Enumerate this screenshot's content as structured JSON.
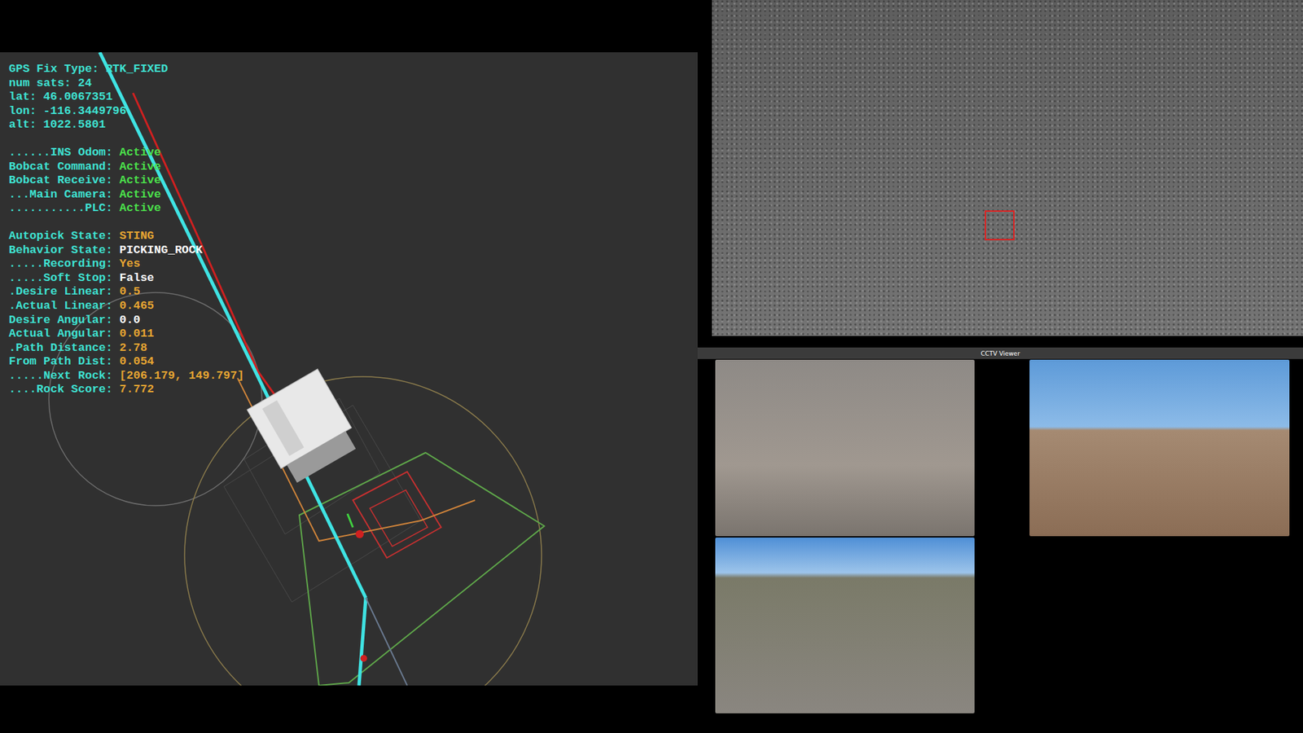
{
  "status_groups": [
    [
      {
        "label": "GPS Fix Type:",
        "value": "RTK_FIXED",
        "color": "#3fe3d3"
      },
      {
        "label": "num sats:",
        "value": "24",
        "color": "#3fe3d3"
      },
      {
        "label": "lat:",
        "value": "46.0067351",
        "color": "#3fe3d3"
      },
      {
        "label": "lon:",
        "value": "-116.3449796",
        "color": "#3fe3d3"
      },
      {
        "label": "alt:",
        "value": "1022.5801",
        "color": "#3fe3d3"
      }
    ],
    [
      {
        "label": "......INS Odom:",
        "value": "Active",
        "color": "#4be24b"
      },
      {
        "label": "Bobcat Command:",
        "value": "Active",
        "color": "#4be24b"
      },
      {
        "label": "Bobcat Receive:",
        "value": "Active",
        "color": "#4be24b"
      },
      {
        "label": "...Main Camera:",
        "value": "Active",
        "color": "#4be24b"
      },
      {
        "label": "...........PLC:",
        "value": "Active",
        "color": "#4be24b"
      }
    ],
    [
      {
        "label": "Autopick State:",
        "value": "STING",
        "color": "#e8a632"
      },
      {
        "label": "Behavior State:",
        "value": "PICKING_ROCK",
        "color": "#ffffff"
      },
      {
        "label": ".....Recording:",
        "value": "Yes",
        "color": "#e8a632"
      },
      {
        "label": ".....Soft Stop:",
        "value": "False",
        "color": "#ffffff"
      },
      {
        "label": ".Desire Linear:",
        "value": "0.5",
        "color": "#e8a632"
      },
      {
        "label": ".Actual Linear:",
        "value": "0.465",
        "color": "#e8a632"
      },
      {
        "label": "Desire Angular:",
        "value": "0.0",
        "color": "#ffffff"
      },
      {
        "label": "Actual Angular:",
        "value": "0.011",
        "color": "#e8a632"
      },
      {
        "label": ".Path Distance:",
        "value": "2.78",
        "color": "#e8a632"
      },
      {
        "label": "From Path Dist:",
        "value": "0.054",
        "color": "#e8a632"
      },
      {
        "label": ".....Next Rock:",
        "value": "[206.179, 149.797]",
        "color": "#e8a632"
      },
      {
        "label": "....Rock Score:",
        "value": "7.772",
        "color": "#e8a632"
      }
    ]
  ],
  "cctv": {
    "title": "CCTV Viewer"
  }
}
